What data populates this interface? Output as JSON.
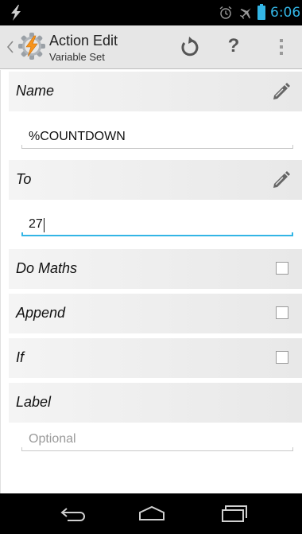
{
  "status_bar": {
    "time": "6:06",
    "icons": [
      "tasker-bolt-icon",
      "alarm-icon",
      "airplane-mode-icon",
      "battery-icon"
    ]
  },
  "action_bar": {
    "title": "Action Edit",
    "subtitle": "Variable Set",
    "icons": [
      "back-chevron-icon",
      "tasker-app-icon",
      "undo-icon",
      "help-icon",
      "overflow-menu-icon"
    ],
    "help_glyph": "?"
  },
  "form": {
    "name": {
      "label": "Name",
      "value": "%COUNTDOWN"
    },
    "to": {
      "label": "To",
      "value": "27"
    },
    "do_maths": {
      "label": "Do Maths",
      "checked": false
    },
    "append": {
      "label": "Append",
      "checked": false
    },
    "if": {
      "label": "If",
      "checked": false
    },
    "label": {
      "label": "Label",
      "placeholder": "Optional"
    }
  },
  "nav_bar": {
    "icons": [
      "back-icon",
      "home-icon",
      "recent-apps-icon"
    ]
  },
  "colors": {
    "accent": "#33b5e5",
    "status_bar": "#000000",
    "action_bar": "#e6e6e6",
    "tasker_orange": "#f7941d"
  }
}
